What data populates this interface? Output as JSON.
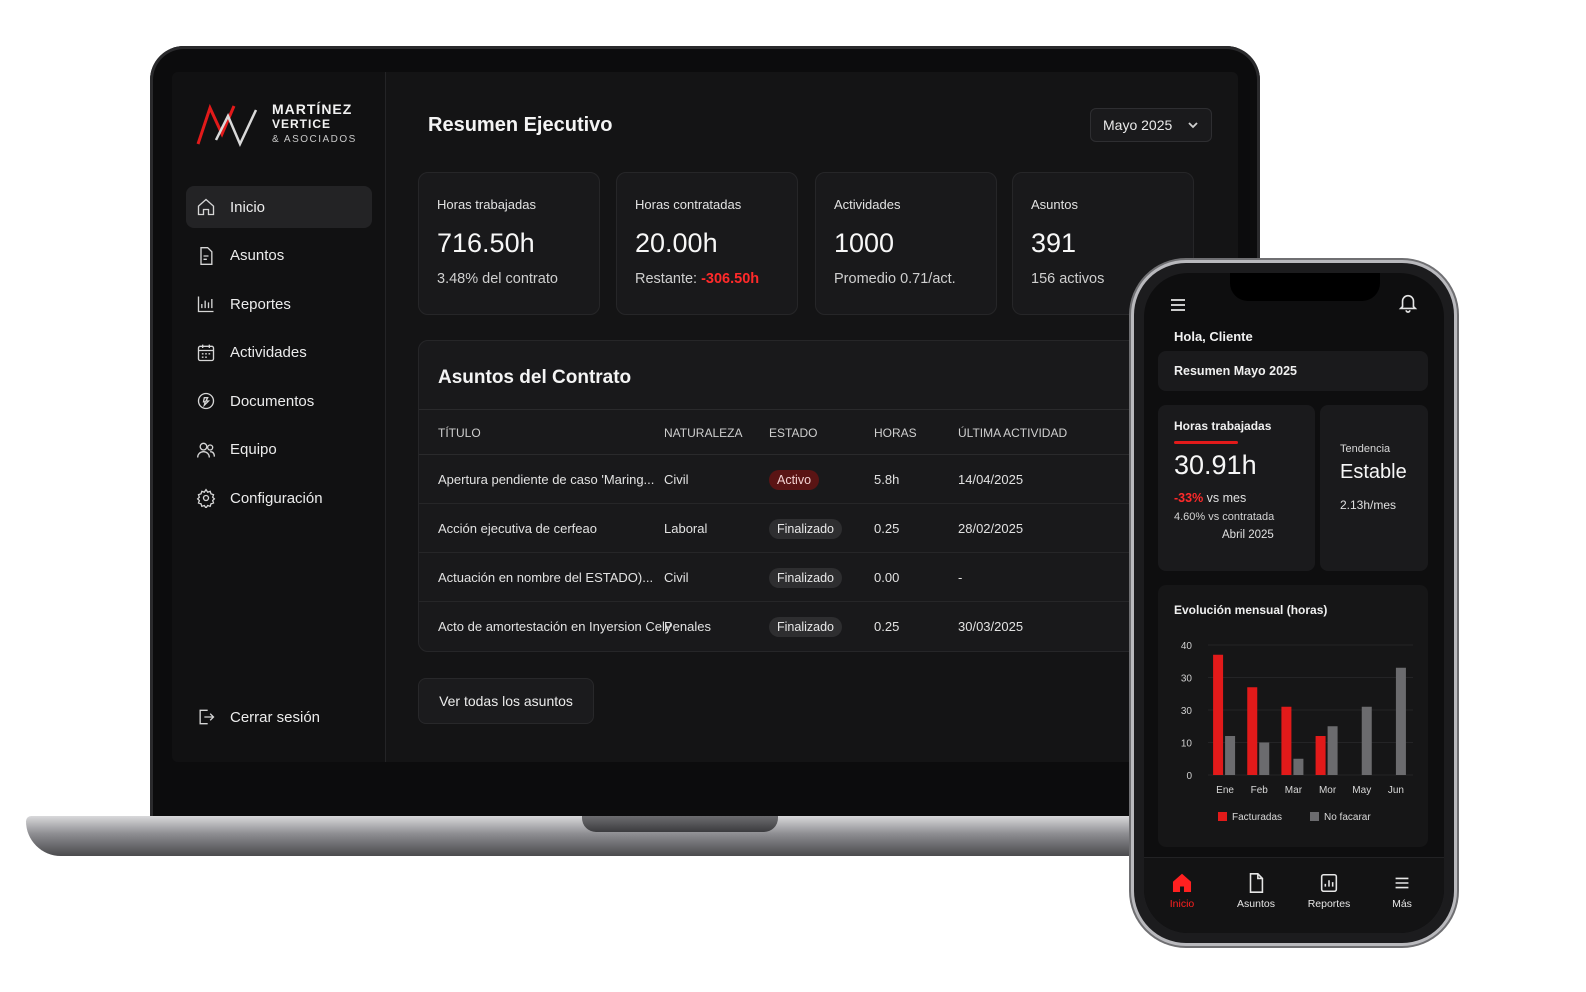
{
  "brand": {
    "line1": "MARTÍNEZ",
    "line2": "VERTICE",
    "line3": "& ASOCIADOS",
    "accent_color": "#e21a1a"
  },
  "sidebar": {
    "items": [
      {
        "label": "Inicio",
        "icon": "home-icon",
        "active": true
      },
      {
        "label": "Asuntos",
        "icon": "document-icon"
      },
      {
        "label": "Reportes",
        "icon": "bar-chart-icon"
      },
      {
        "label": "Actividades",
        "icon": "calendar-icon"
      },
      {
        "label": "Documentos",
        "icon": "file-icon"
      },
      {
        "label": "Equipo",
        "icon": "users-icon"
      },
      {
        "label": "Configuración",
        "icon": "gear-icon"
      }
    ],
    "logout": "Cerrar sesión"
  },
  "header": {
    "title": "Resumen Ejecutivo",
    "month": "Mayo 2025"
  },
  "kpis": [
    {
      "label": "Horas trabajadas",
      "value": "716.50h",
      "sub": "3.48% del contrato"
    },
    {
      "label": "Horas contratadas",
      "value": "20.00h",
      "sub_prefix": "Restante: ",
      "sub_neg": "-306.50h"
    },
    {
      "label": "Actividades",
      "value": "1000",
      "sub": "Promedio 0.71/act."
    },
    {
      "label": "Asuntos",
      "value": "391",
      "sub": "156 activos"
    }
  ],
  "table": {
    "title": "Asuntos del Contrato",
    "columns": [
      "TÍTULO",
      "NATURALEZA",
      "ESTADO",
      "HORAS",
      "ÚLTIMA ACTIVIDAD"
    ],
    "rows": [
      {
        "titulo": "Apertura pendiente de caso 'Maring...",
        "naturaleza": "Civil",
        "estado": "Activo",
        "horas": "5.8h",
        "ultima": "14/04/2025"
      },
      {
        "titulo": "Acción ejecutiva de cerfeao",
        "naturaleza": "Laboral",
        "estado": "Finalizado",
        "horas": "0.25",
        "ultima": "28/02/2025"
      },
      {
        "titulo": "Actuación en nombre del ESTADO)...",
        "naturaleza": "Civil",
        "estado": "Finalizado",
        "horas": "0.00",
        "ultima": "-"
      },
      {
        "titulo": "Acto de amortestación en Inyersion Cely",
        "naturaleza": "Penales",
        "estado": "Finalizado",
        "horas": "0.25",
        "ultima": "30/03/2025"
      }
    ],
    "view_all": "Ver todas los asuntos"
  },
  "phone": {
    "greeting": "Hola, Cliente",
    "summary": "Resumen Mayo 2025",
    "hours": {
      "label": "Horas trabajadas",
      "value": "30.91h",
      "delta_neg": "-33%",
      "delta_text": " vs mes",
      "contracted": "4.60% vs contratada",
      "period": "Abril 2025"
    },
    "trend": {
      "label": "Tendencia",
      "value": "Estable",
      "rate": "2.13h/mes"
    },
    "chart_title": "Evolución mensual (horas)",
    "tabs": [
      {
        "label": "Inicio",
        "icon": "home-icon",
        "active": true
      },
      {
        "label": "Asuntos",
        "icon": "document-icon"
      },
      {
        "label": "Reportes",
        "icon": "report-icon"
      },
      {
        "label": "Más",
        "icon": "list-icon"
      }
    ]
  },
  "chart_data": {
    "type": "bar",
    "title": "Evolución mensual (horas)",
    "categories": [
      "Ene",
      "Feb",
      "Mar",
      "Mor",
      "May",
      "Jun"
    ],
    "y_ticks": [
      "40",
      "30",
      "30",
      "10",
      "0"
    ],
    "ylim": [
      0,
      40
    ],
    "series": [
      {
        "name": "Facturadas",
        "color": "#e21a1a",
        "values": [
          37,
          27,
          21,
          12,
          null,
          null
        ]
      },
      {
        "name": "No facarar",
        "color": "#6b6b6e",
        "values": [
          12,
          10,
          5,
          15,
          21,
          33
        ]
      }
    ],
    "legend_position": "bottom"
  }
}
